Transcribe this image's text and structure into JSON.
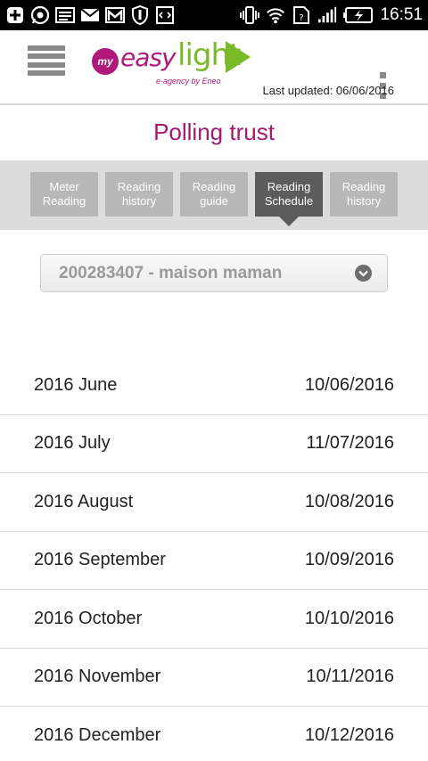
{
  "status_bar": {
    "time": "16:51",
    "icons": [
      "plus-box-icon",
      "whatsapp-icon",
      "image-icon",
      "mail-icon",
      "gmail-icon",
      "shield-icon",
      "code-icon",
      "vibrate-icon",
      "wifi-icon",
      "sim-icon",
      "signal-icon",
      "battery-icon"
    ]
  },
  "header": {
    "logo": {
      "my": "my",
      "easy": "easy",
      "light": "light",
      "tagline": "e-agency by Eneo"
    },
    "last_updated": "Last updated: 06/06/2016"
  },
  "page_title": "Polling trust",
  "tabs": [
    {
      "label": "Meter\nReading",
      "active": false
    },
    {
      "label": "Reading\nhistory",
      "active": false
    },
    {
      "label": "Reading\nguide",
      "active": false
    },
    {
      "label": "Reading\nSchedule",
      "active": true
    },
    {
      "label": "Reading\nhistory",
      "active": false
    }
  ],
  "account_select": {
    "value": "200283407 - maison maman"
  },
  "schedule": [
    {
      "month": "2016 June",
      "date": "10/06/2016"
    },
    {
      "month": "2016 July",
      "date": "11/07/2016"
    },
    {
      "month": "2016 August",
      "date": "10/08/2016"
    },
    {
      "month": "2016 September",
      "date": "10/09/2016"
    },
    {
      "month": "2016 October",
      "date": "10/10/2016"
    },
    {
      "month": "2016 November",
      "date": "10/11/2016"
    },
    {
      "month": "2016 December",
      "date": "10/12/2016"
    }
  ],
  "colors": {
    "brand_magenta": "#a4196f",
    "brand_green": "#7ab929",
    "tab_inactive": "#b8b8b8",
    "tab_active": "#5c5c5c"
  }
}
